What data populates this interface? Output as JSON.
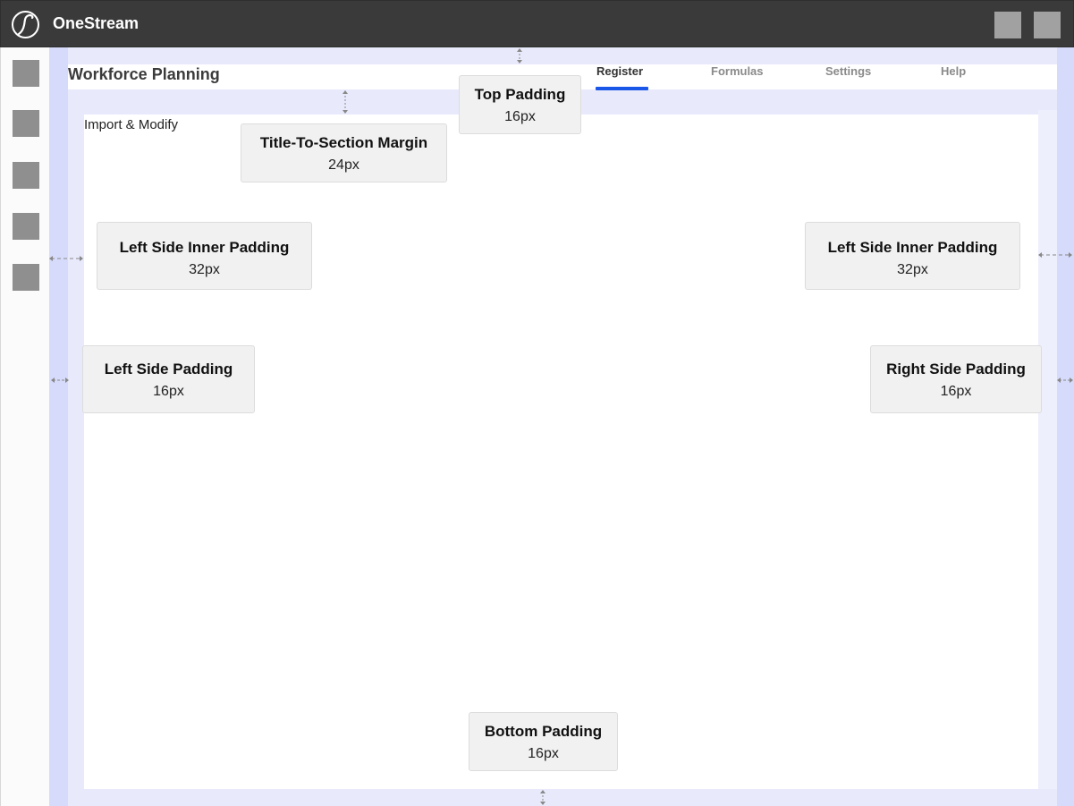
{
  "app": {
    "name": "OneStream"
  },
  "page": {
    "title": "Workforce Planning",
    "tabs": [
      {
        "label": "Register",
        "active": true
      },
      {
        "label": "Formulas",
        "active": false
      },
      {
        "label": "Settings",
        "active": false
      },
      {
        "label": "Help",
        "active": false
      }
    ]
  },
  "section": {
    "title": "Import & Modify"
  },
  "annotations": {
    "top_padding": {
      "title": "Top Padding",
      "value": "16px"
    },
    "title_to_section": {
      "title": "Title-To-Section Margin",
      "value": "24px"
    },
    "left_inner_padding": {
      "title": "Left Side Inner Padding",
      "value": "32px"
    },
    "right_inner_padding": {
      "title": "Left Side Inner Padding",
      "value": "32px"
    },
    "left_padding": {
      "title": "Left Side Padding",
      "value": "16px"
    },
    "right_padding": {
      "title": "Right Side Padding",
      "value": "16px"
    },
    "bottom_padding": {
      "title": "Bottom Padding",
      "value": "16px"
    }
  },
  "colors": {
    "topbar": "#3a3a3a",
    "accent": "#1a56e8",
    "padding_highlight": "#d7dbfb",
    "margin_highlight": "#e8eafc"
  },
  "icons": {
    "logo": "onestream-logo-icon",
    "vertical_measure": "vertical-measure-icon",
    "horizontal_measure": "horizontal-measure-icon"
  }
}
